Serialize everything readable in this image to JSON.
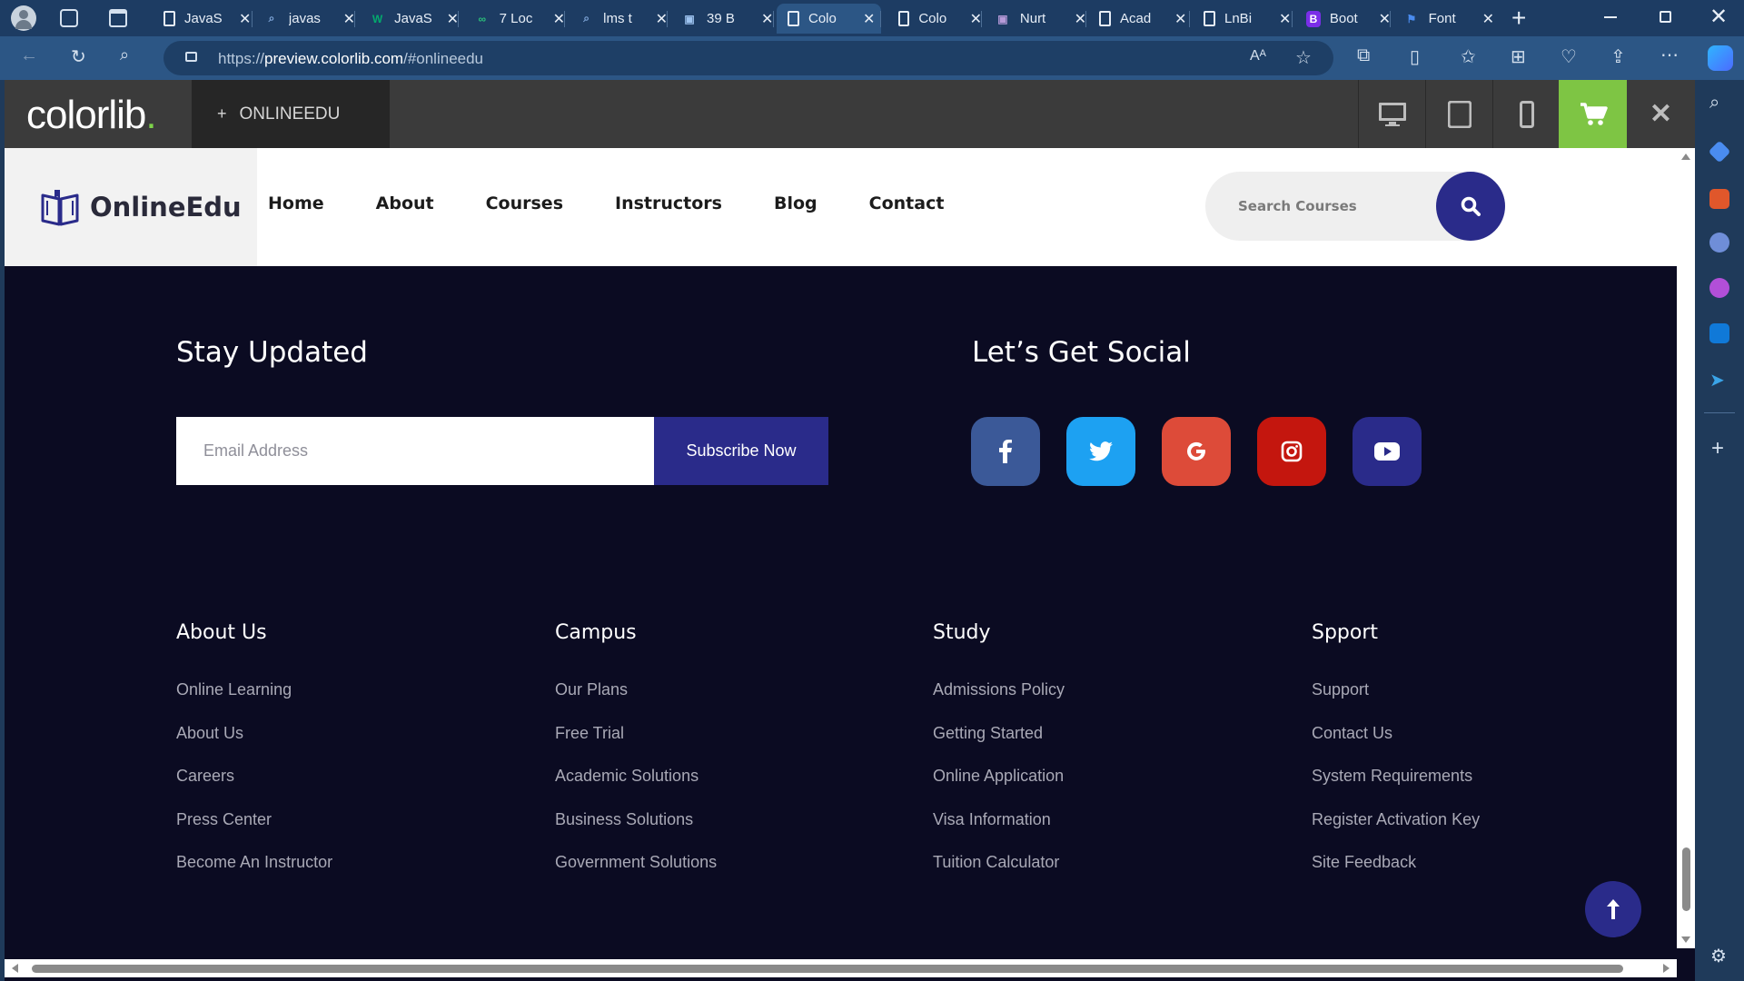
{
  "browser": {
    "tabs": [
      {
        "label": "JavaS",
        "icon": "page-icon",
        "active": false
      },
      {
        "label": "javas",
        "icon": "search-icon",
        "active": false
      },
      {
        "label": "JavaS",
        "icon": "w3-icon",
        "active": false
      },
      {
        "label": "7 Loc",
        "icon": "code-icon",
        "active": false
      },
      {
        "label": "lms t",
        "icon": "search-icon",
        "active": false
      },
      {
        "label": "39 B",
        "icon": "app-icon",
        "active": false
      },
      {
        "label": "Colo",
        "icon": "page-icon",
        "active": true
      },
      {
        "label": "Colo",
        "icon": "page-icon",
        "active": false
      },
      {
        "label": "Nurt",
        "icon": "site-icon",
        "active": false
      },
      {
        "label": "Acad",
        "icon": "page-icon",
        "active": false
      },
      {
        "label": "LnBi",
        "icon": "page-icon",
        "active": false
      },
      {
        "label": "Boot",
        "icon": "bootstrap-icon",
        "active": false
      },
      {
        "label": "Font",
        "icon": "flag-icon",
        "active": false
      }
    ],
    "url_host": "preview.colorlib.com",
    "url_prefix": "https://",
    "url_path": "/#onlineedu"
  },
  "demo_bar": {
    "logo_main": "colorlib",
    "logo_dot": ".",
    "tab_label": "ONLINEEDU",
    "tab_plus": "+"
  },
  "site": {
    "logo": "OnlineEdu",
    "nav": [
      "Home",
      "About",
      "Courses",
      "Instructors",
      "Blog",
      "Contact"
    ],
    "search_placeholder": "Search Courses"
  },
  "newsletter": {
    "title": "Stay Updated",
    "email_placeholder": "Email Address",
    "button": "Subscribe Now"
  },
  "social": {
    "title": "Let’s Get Social",
    "items": [
      {
        "name": "facebook",
        "color": "#3b5998"
      },
      {
        "name": "twitter",
        "color": "#1da1f2"
      },
      {
        "name": "google",
        "color": "#dd4b39"
      },
      {
        "name": "instagram",
        "color": "#c4160e"
      },
      {
        "name": "youtube",
        "color": "#2a2b8a"
      }
    ]
  },
  "footer_columns": [
    {
      "title": "About Us",
      "links": [
        "Online Learning",
        "About Us",
        "Careers",
        "Press Center",
        "Become An Instructor"
      ]
    },
    {
      "title": "Campus",
      "links": [
        "Our Plans",
        "Free Trial",
        "Academic Solutions",
        "Business Solutions",
        "Government Solutions"
      ]
    },
    {
      "title": "Study",
      "links": [
        "Admissions Policy",
        "Getting Started",
        "Online Application",
        "Visa Information",
        "Tuition Calculator"
      ]
    },
    {
      "title": "Spport",
      "links": [
        "Support",
        "Contact Us",
        "System Requirements",
        "Register Activation Key",
        "Site Feedback"
      ]
    }
  ],
  "colors": {
    "accent": "#2a2b8a",
    "footer_bg": "#0b0b22",
    "cart_green": "#7ec544"
  }
}
